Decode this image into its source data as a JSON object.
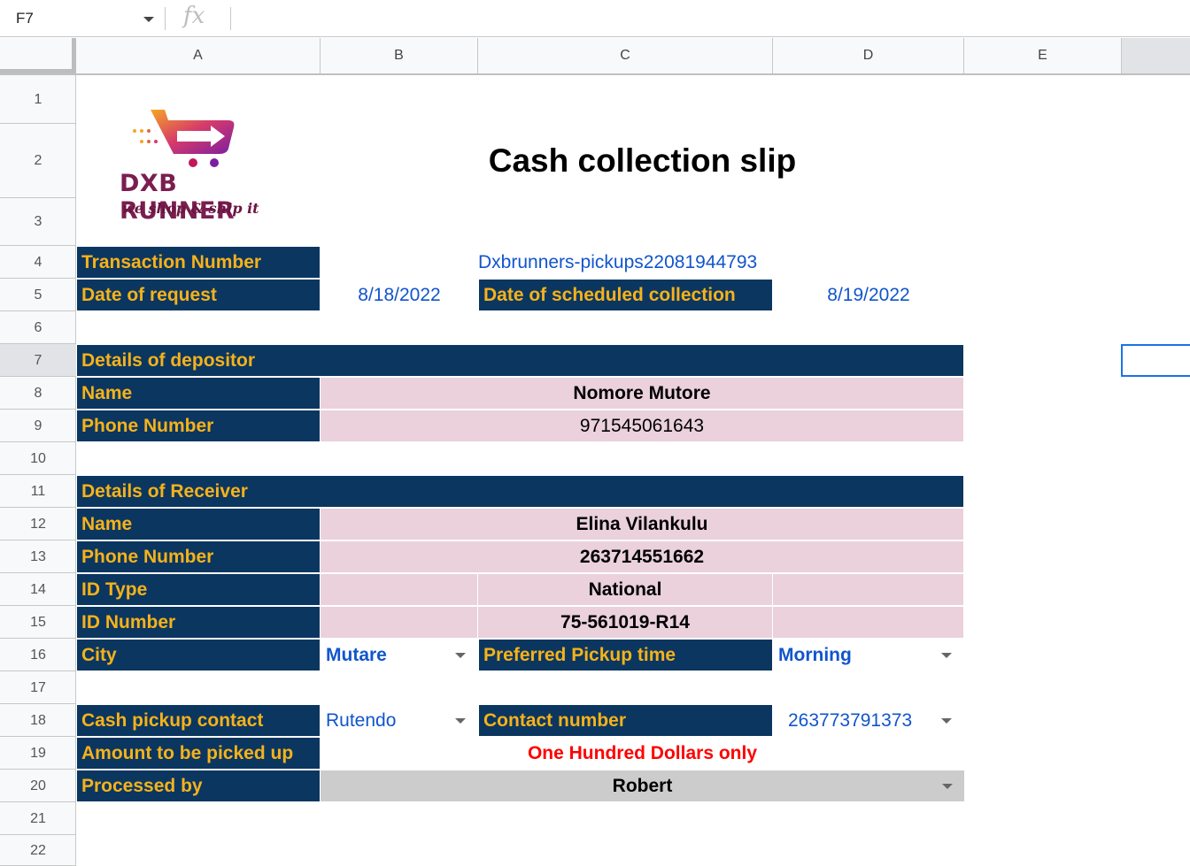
{
  "formula_bar": {
    "cell_ref": "F7",
    "fx_label": "fx"
  },
  "columns": [
    "A",
    "B",
    "C",
    "D",
    "E"
  ],
  "rows": [
    "1",
    "2",
    "3",
    "4",
    "5",
    "6",
    "7",
    "8",
    "9",
    "10",
    "11",
    "12",
    "13",
    "14",
    "15",
    "16",
    "17",
    "18",
    "19",
    "20",
    "21",
    "22"
  ],
  "logo": {
    "name": "DXB RUNNER",
    "tagline": "we shop & ship it",
    "colors": [
      "#f5a623",
      "#c2185b",
      "#7b1fa2"
    ]
  },
  "title": "Cash collection slip",
  "transaction": {
    "label": "Transaction Number",
    "value": "Dxbrunners-pickups22081944793"
  },
  "request": {
    "label": "Date of request",
    "value": "8/18/2022"
  },
  "scheduled": {
    "label": "Date of scheduled collection",
    "value": "8/19/2022"
  },
  "depositor": {
    "header": "Details of depositor",
    "name_label": "Name",
    "name": "Nomore Mutore",
    "phone_label": "Phone Number",
    "phone": "971545061643"
  },
  "receiver": {
    "header": "Details of Receiver",
    "name_label": "Name",
    "name": "Elina Vilankulu",
    "phone_label": "Phone Number",
    "phone": "263714551662",
    "id_type_label": "ID Type",
    "id_type": "National",
    "id_number_label": "ID Number",
    "id_number": "75-561019-R14",
    "city_label": "City",
    "city": "Mutare",
    "pickup_time_label": "Preferred Pickup time",
    "pickup_time": "Morning"
  },
  "pickup": {
    "contact_label": "Cash pickup contact",
    "contact": "Rutendo",
    "contact_number_label": "Contact number",
    "contact_number": "263773791373",
    "amount_label": "Amount to be picked up",
    "amount": "One Hundred Dollars only",
    "processed_label": "Processed by",
    "processed_by": "Robert"
  },
  "colors": {
    "label_bg": "#0b3660",
    "label_text": "#f6b21a",
    "pink": "#ead1dc",
    "blue": "#1155cc",
    "red": "#ff0000",
    "grey": "#cccccc"
  }
}
